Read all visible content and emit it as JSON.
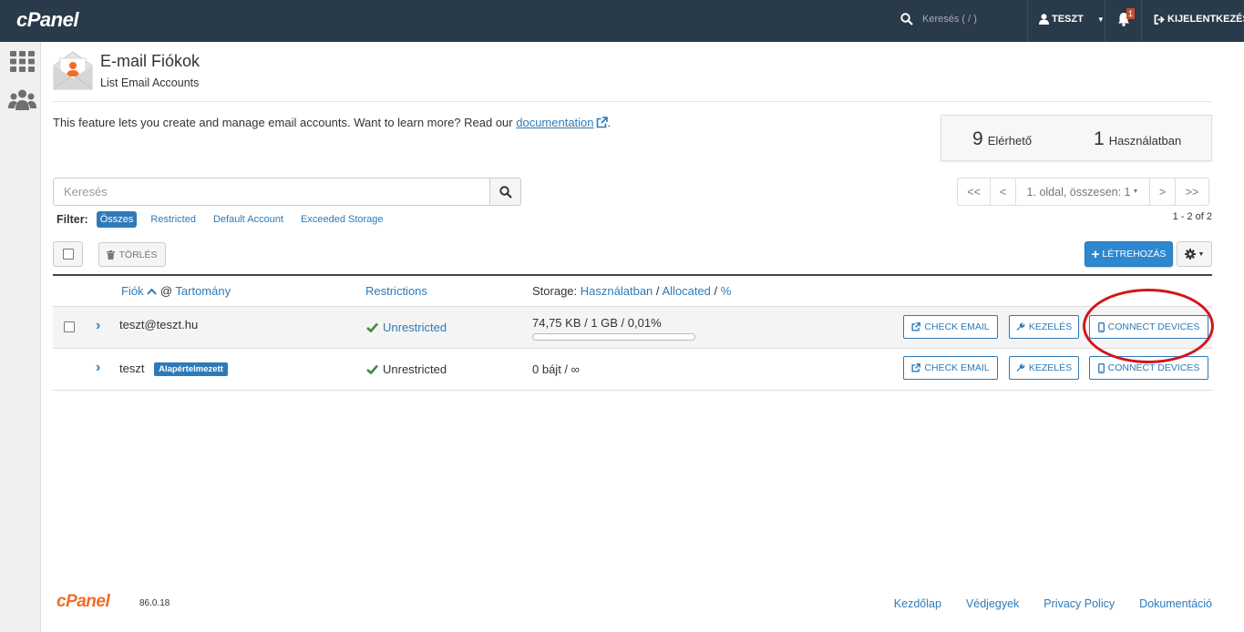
{
  "topbar": {
    "logo": "cPanel",
    "search_placeholder": "Keresés ( / )",
    "user": "TESZT",
    "notifications_count": "1",
    "logout": "KIJELENTKEZÉS"
  },
  "header": {
    "title": "E-mail Fiókok",
    "subtitle": "List Email Accounts"
  },
  "description": {
    "text": "This feature lets you create and manage email accounts. Want to learn more? Read our ",
    "link": "documentation",
    "suffix": "."
  },
  "stats": {
    "available_count": "9",
    "available_label": "Elérhető",
    "used_count": "1",
    "used_label": "Használatban"
  },
  "search": {
    "placeholder": "Keresés"
  },
  "pagination": {
    "first": "<<",
    "prev": "<",
    "page_label": "1. oldal, összesen: 1",
    "next": ">",
    "last": ">>",
    "range": "1 - 2 of 2"
  },
  "filter": {
    "label": "Filter:",
    "items": [
      "Összes",
      "Restricted",
      "Default Account",
      "Exceeded Storage"
    ]
  },
  "toolbar": {
    "delete_label": "TÖRLÉS",
    "create_label": "LÉTREHOZÁS"
  },
  "table": {
    "col_account": "Fiók",
    "col_at": "@",
    "col_domain": "Tartomány",
    "col_restrictions": "Restrictions",
    "col_storage_prefix": "Storage:",
    "col_storage_used": "Használatban",
    "col_storage_sep1": "/",
    "col_storage_allocated": "Allocated",
    "col_storage_sep2": "/",
    "col_storage_percent": "%",
    "rows": [
      {
        "account": "teszt@teszt.hu",
        "restriction": "Unrestricted",
        "storage": "74,75 KB / 1 GB / 0,01%",
        "usage_fraction": 0.0001,
        "check_email": "CHECK EMAIL",
        "manage": "KEZELÉS",
        "connect": "CONNECT DEVICES"
      },
      {
        "account": "teszt",
        "badge": "Alapértelmezett",
        "restriction": "Unrestricted",
        "storage": "0 bájt / ∞",
        "check_email": "CHECK EMAIL",
        "manage": "KEZELÉS",
        "connect": "CONNECT DEVICES"
      }
    ]
  },
  "footer": {
    "logo": "cPanel",
    "version": "86.0.18",
    "links": [
      "Kezdőlap",
      "Védjegyek",
      "Privacy Policy",
      "Dokumentáció"
    ]
  },
  "colors": {
    "topbar": "#293a4a",
    "accent": "#2e7ab8",
    "brand_orange": "#f26c25",
    "highlight_circle": "#d2161a"
  }
}
